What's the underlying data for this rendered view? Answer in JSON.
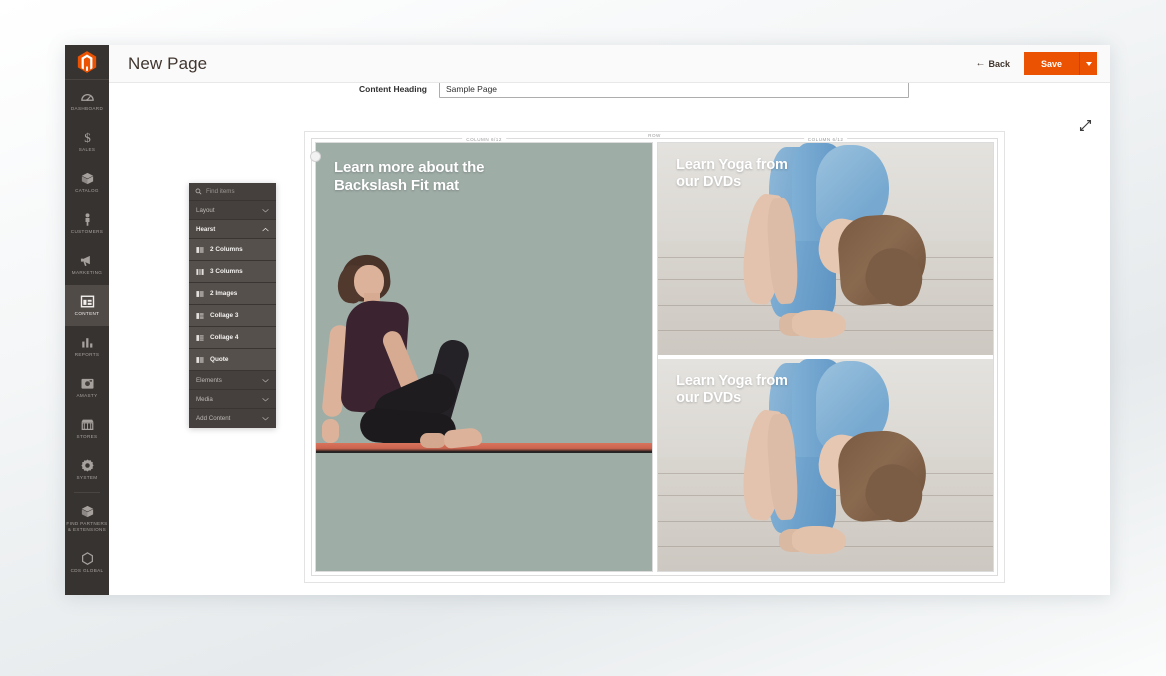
{
  "header": {
    "title": "New Page",
    "back_label": "Back",
    "back_icon": "arrow-left-icon",
    "save_label": "Save",
    "save_dropdown_icon": "caret-down-icon"
  },
  "form": {
    "content_heading_label": "Content Heading",
    "content_heading_value": "Sample Page"
  },
  "sidebar": {
    "logo_icon": "magento-logo-icon",
    "items": [
      {
        "label": "DASHBOARD",
        "icon": "dashboard-gauge-icon",
        "active": false
      },
      {
        "label": "SALES",
        "icon": "dollar-sign-icon",
        "active": false
      },
      {
        "label": "CATALOG",
        "icon": "box-icon",
        "active": false
      },
      {
        "label": "CUSTOMERS",
        "icon": "person-icon",
        "active": false
      },
      {
        "label": "MARKETING",
        "icon": "megaphone-icon",
        "active": false
      },
      {
        "label": "CONTENT",
        "icon": "content-layout-icon",
        "active": true
      },
      {
        "label": "REPORTS",
        "icon": "bar-chart-icon",
        "active": false
      },
      {
        "label": "AMASTY",
        "icon": "amasty-icon",
        "active": false
      },
      {
        "label": "STORES",
        "icon": "storefront-icon",
        "active": false
      },
      {
        "label": "SYSTEM",
        "icon": "gear-icon",
        "active": false
      },
      {
        "label": "FIND PARTNERS\n& EXTENSIONS",
        "icon": "package-icon",
        "active": false
      },
      {
        "label": "CDS GLOBAL",
        "icon": "hexagon-icon",
        "active": false
      }
    ]
  },
  "tool_panel": {
    "search_icon": "search-icon",
    "search_placeholder": "Find items",
    "groups": [
      {
        "label": "Layout",
        "state": "collapsed",
        "icon": "chevron-down-icon"
      },
      {
        "label": "Hearst",
        "state": "expanded",
        "icon": "chevron-up-icon"
      }
    ],
    "items": [
      {
        "label": "2 Columns",
        "icon": "columns-2-icon"
      },
      {
        "label": "3 Columns",
        "icon": "columns-3-icon"
      },
      {
        "label": "2 Images",
        "icon": "images-2-icon"
      },
      {
        "label": "Collage 3",
        "icon": "collage-3-icon"
      },
      {
        "label": "Collage 4",
        "icon": "collage-4-icon"
      },
      {
        "label": "Quote",
        "icon": "quote-icon"
      }
    ],
    "footer_groups": [
      {
        "label": "Elements",
        "state": "collapsed",
        "icon": "chevron-down-icon"
      },
      {
        "label": "Media",
        "state": "collapsed",
        "icon": "chevron-down-icon"
      },
      {
        "label": "Add Content",
        "state": "collapsed",
        "icon": "chevron-down-icon"
      }
    ]
  },
  "canvas": {
    "fullscreen_icon": "expand-diagonal-icon",
    "row_label": "ROW",
    "drag_handle_icon": "drag-handle-icon",
    "left_column": {
      "label": "COLUMN 6/12",
      "banner_heading": "Learn more about the\nBackslash Fit mat",
      "background_color": "#9fada7"
    },
    "right_column": {
      "label": "COLUMN 6/12",
      "banners": [
        {
          "banner_heading": "Learn Yoga from\nour DVDs"
        },
        {
          "banner_heading": "Learn Yoga from\nour DVDs"
        }
      ]
    }
  },
  "colors": {
    "accent_orange": "#eb5202",
    "sidebar_dark": "#373330",
    "panel_dark": "#45403d",
    "mat_coral": "#cb6450",
    "banner_sage": "#9fada7"
  }
}
